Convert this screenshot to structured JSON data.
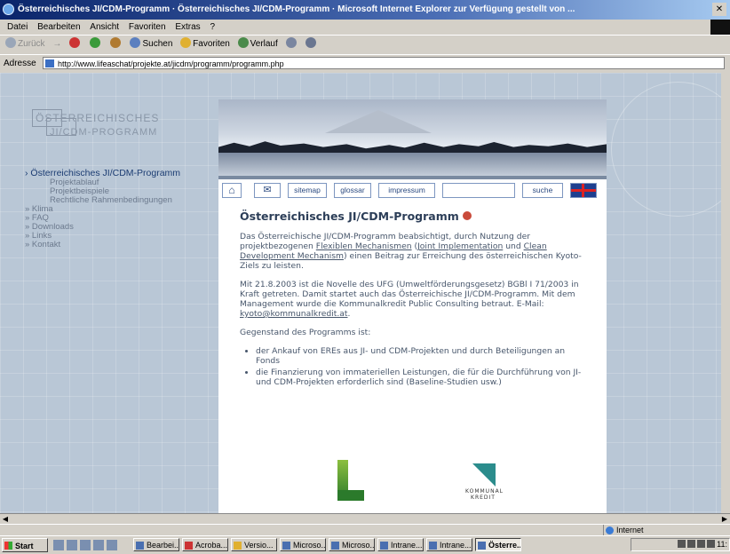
{
  "window": {
    "title": "Österreichisches JI/CDM-Programm · Österreichisches JI/CDM-Programm · Microsoft Internet Explorer zur Verfügung gestellt von ...",
    "close_btn": "✕"
  },
  "menu": [
    "Datei",
    "Bearbeiten",
    "Ansicht",
    "Favoriten",
    "Extras",
    "?"
  ],
  "toolbar": {
    "back": "Zurück",
    "forward": "→",
    "search": "Suchen",
    "favorites": "Favoriten",
    "history": "Verlauf"
  },
  "address": {
    "label": "Adresse",
    "url": "http://www.lifeaschat/projekte.at/jicdm/programm/programm.php"
  },
  "site": {
    "logo_line1": "ÖSTERREICHISCHES",
    "logo_line2": "JI/CDM-PROGRAMM",
    "nav": [
      {
        "label": "› Österreichisches JI/CDM-Programm",
        "level": "active"
      },
      {
        "label": "Projektablauf",
        "level": "sub"
      },
      {
        "label": "Projektbeispiele",
        "level": "sub"
      },
      {
        "label": "Rechtliche Rahmenbedingungen",
        "level": "sub"
      },
      {
        "label": "» Klima",
        "level": "top"
      },
      {
        "label": "» FAQ",
        "level": "top"
      },
      {
        "label": "» Downloads",
        "level": "top"
      },
      {
        "label": "» Links",
        "level": "top"
      },
      {
        "label": "» Kontakt",
        "level": "top"
      }
    ],
    "buttons": {
      "home": "⌂",
      "mail": "✉",
      "sitemap": "sitemap",
      "glossar": "glossar",
      "impressum": "impressum",
      "suche": "suche"
    },
    "search_value": ""
  },
  "content": {
    "heading": "Österreichisches JI/CDM-Programm",
    "p1_pre": "Das Österreichische JI/CDM-Programm beabsichtigt, durch Nutzung der projektbezogenen ",
    "p1_link1": "Flexiblen Mechanismen",
    "p1_mid1": " (",
    "p1_link2": "Joint Implementation",
    "p1_mid2": " und ",
    "p1_link3": "Clean Development Mechanism",
    "p1_post": ") einen Beitrag zur Erreichung des österreichischen Kyoto-Ziels zu leisten.",
    "p2_pre": "Mit 21.8.2003 ist die Novelle des UFG (Umweltförderungsgesetz) BGBl I 71/2003 in Kraft getreten. Damit startet auch das Österreichische JI/CDM-Programm. Mit dem Management wurde die Kommunalkredit Public Consulting betraut. E-Mail: ",
    "p2_email": "kyoto@kommunalkredit.at",
    "p2_post": ".",
    "p3": "Gegenstand des Programms ist:",
    "bullets": [
      "der Ankauf von EREs aus JI- und CDM-Projekten und durch Beteiligungen an Fonds",
      "die Finanzierung von immateriellen Leistungen, die für die Durchführung von JI- und CDM-Projekten erforderlich sind (Baseline-Studien usw.)"
    ],
    "logo_kk": "KOMMUNAL KREDIT"
  },
  "status": {
    "zone": "Internet"
  },
  "taskbar": {
    "start": "Start",
    "tasks": [
      "Bearbei...",
      "Acroba...",
      "Versio...",
      "Microso...",
      "Microso...",
      "Intrane...",
      "Intrane...",
      "Österre..."
    ],
    "clock": "11:"
  },
  "colors": {
    "accent": "#1b3c72",
    "banner_sky": "#aab6c8",
    "page_bg": "#b9c7d6"
  }
}
